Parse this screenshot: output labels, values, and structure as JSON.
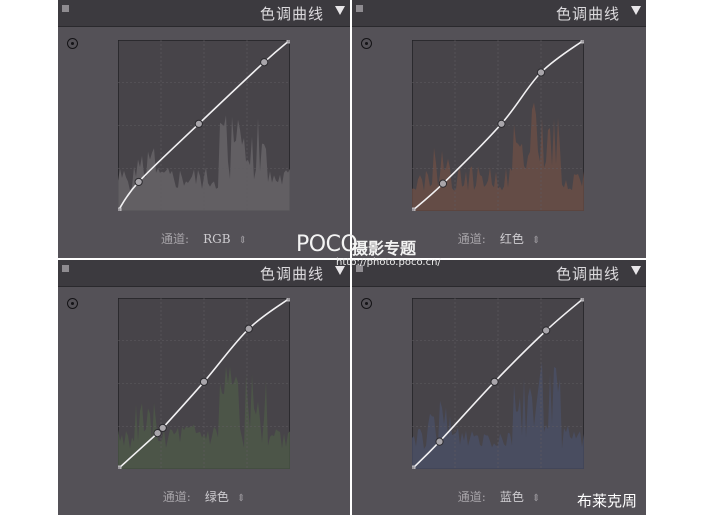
{
  "panels": [
    {
      "title": "色调曲线",
      "channel_label": "通道:",
      "channel_value": "RGB",
      "channel_arrow": "⇕",
      "histogram_color": "#6b686c",
      "curve_points": [
        [
          0,
          0
        ],
        [
          0.12,
          0.17
        ],
        [
          0.47,
          0.51
        ],
        [
          0.85,
          0.87
        ],
        [
          1,
          1
        ]
      ]
    },
    {
      "title": "色调曲线",
      "channel_label": "通道:",
      "channel_value": "红色",
      "channel_arrow": "⇕",
      "histogram_color": "#6e4f45",
      "curve_points": [
        [
          0,
          0
        ],
        [
          0.18,
          0.16
        ],
        [
          0.52,
          0.51
        ],
        [
          0.75,
          0.81
        ],
        [
          1,
          1
        ]
      ]
    },
    {
      "title": "色调曲线",
      "channel_label": "通道:",
      "channel_value": "绿色",
      "channel_arrow": "⇕",
      "histogram_color": "#4d5b48",
      "curve_points": [
        [
          0,
          0
        ],
        [
          0.23,
          0.21
        ],
        [
          0.26,
          0.24
        ],
        [
          0.5,
          0.51
        ],
        [
          0.76,
          0.82
        ],
        [
          1,
          1
        ]
      ]
    },
    {
      "title": "色调曲线",
      "channel_label": "通道:",
      "channel_value": "蓝色",
      "channel_arrow": "⇕",
      "histogram_color": "#4a5068",
      "curve_points": [
        [
          0,
          0
        ],
        [
          0.16,
          0.16
        ],
        [
          0.48,
          0.51
        ],
        [
          0.78,
          0.81
        ],
        [
          1,
          1
        ]
      ]
    }
  ],
  "watermark": {
    "logo": "POCO",
    "name": "摄影专题",
    "url": "http://photo.poco.cn/"
  },
  "credit": "布莱克周"
}
